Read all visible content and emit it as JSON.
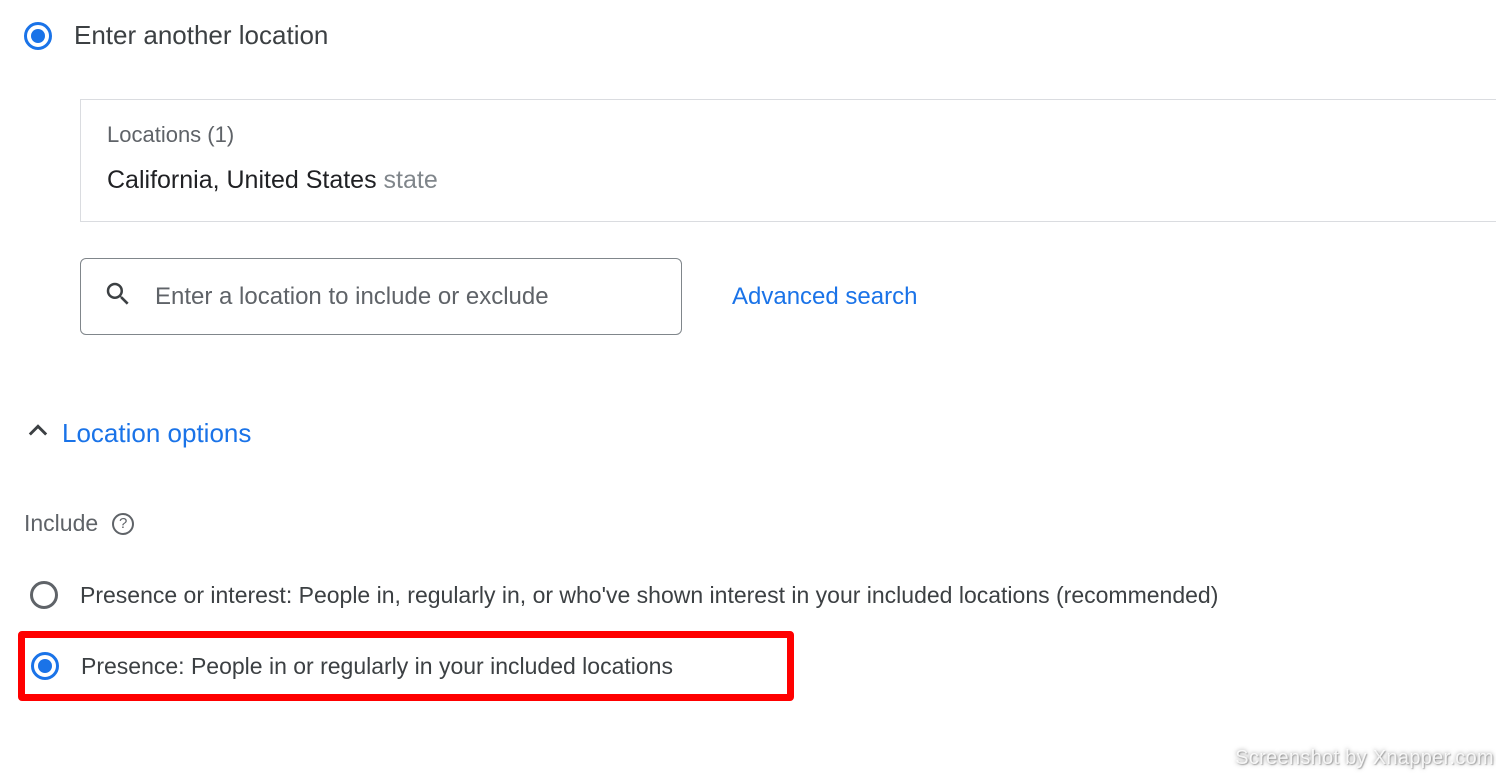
{
  "top": {
    "label": "Enter another location"
  },
  "locations": {
    "header": "Locations (1)",
    "entry_name": "California, United States",
    "entry_type": "state"
  },
  "search": {
    "placeholder": "Enter a location to include or exclude",
    "advanced": "Advanced search"
  },
  "options": {
    "title": "Location options",
    "include_label": "Include",
    "items": [
      "Presence or interest: People in, regularly in, or who've shown interest in your included locations (recommended)",
      "Presence: People in or regularly in your included locations"
    ]
  },
  "watermark": "Screenshot by Xnapper.com"
}
